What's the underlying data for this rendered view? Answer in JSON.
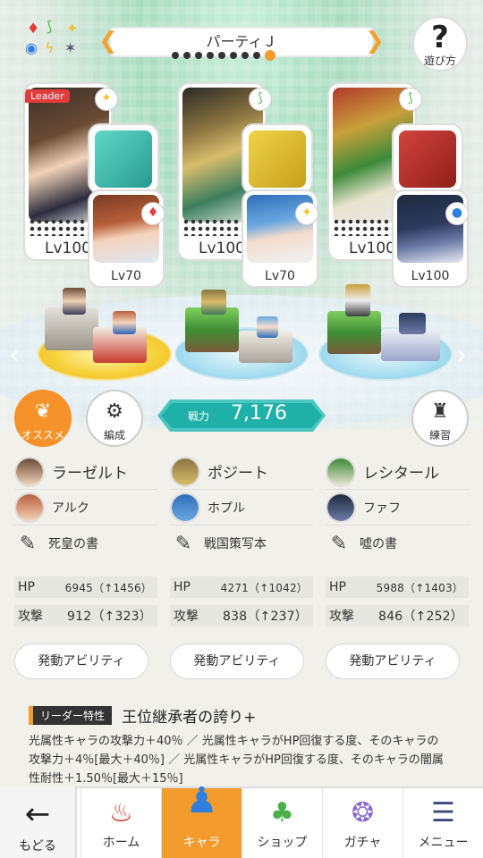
{
  "header": {
    "title": "パーティＪ",
    "page_count": 9,
    "active_page": 9,
    "help_label": "遊び方"
  },
  "colors": {
    "accent": "#f39b2c",
    "power_bg": "#1fb0a8",
    "leader_tag": "#e23b3b"
  },
  "party": [
    {
      "leader_tag": "Leader",
      "main_level": "Lv100",
      "main_element": "light",
      "main_badge": "✦",
      "sub_level": "Lv70",
      "sub_element": "fire",
      "sub_badge": "♦"
    },
    {
      "leader_tag": "",
      "main_level": "Lv100",
      "main_element": "wind",
      "main_badge": "⟆",
      "sub_level": "Lv70",
      "sub_element": "light",
      "sub_badge": "✦"
    },
    {
      "leader_tag": "",
      "main_level": "Lv100",
      "main_element": "wind",
      "main_badge": "⟆",
      "sub_level": "Lv100",
      "sub_element": "dark",
      "sub_badge": "●"
    }
  ],
  "buttons": {
    "recommend": "オススメ",
    "organize": "編成",
    "practice": "練習"
  },
  "power": {
    "label": "戦力",
    "value": "7,176"
  },
  "members": [
    {
      "main_name": "ラーゼルト",
      "sub_name": "アルク",
      "book": "死皇の書",
      "hp_label": "HP",
      "hp": "6945（↑1456）",
      "atk_label": "攻撃",
      "atk": "912（↑323）",
      "ability_label": "発動アビリティ"
    },
    {
      "main_name": "ポジート",
      "sub_name": "ホプル",
      "book": "戦国策写本",
      "hp_label": "HP",
      "hp": "4271（↑1042）",
      "atk_label": "攻撃",
      "atk": "838（↑237）",
      "ability_label": "発動アビリティ"
    },
    {
      "main_name": "レシタール",
      "sub_name": "ファフ",
      "book": "噓の書",
      "hp_label": "HP",
      "hp": "5988（↑1403）",
      "atk_label": "攻撃",
      "atk": "846（↑252）",
      "ability_label": "発動アビリティ"
    }
  ],
  "leader_skill": {
    "tag": "リーダー特性",
    "title": "王位継承者の誇り+",
    "description": "光属性キャラの攻撃力＋40％ ／ 光属性キャラがHP回復する度、そのキャラの攻撃力＋4％[最大＋40％] ／ 光属性キャラがHP回復する度、そのキャラの闇属性耐性＋1.50％[最大＋15％]"
  },
  "bottom_nav": {
    "back": "もどる",
    "tabs": [
      {
        "label": "ホーム",
        "icon": "home-icon"
      },
      {
        "label": "キャラ",
        "icon": "character-icon",
        "active": true
      },
      {
        "label": "ショップ",
        "icon": "shop-icon"
      },
      {
        "label": "ガチャ",
        "icon": "gacha-icon"
      },
      {
        "label": "メニュー",
        "icon": "menu-icon"
      }
    ]
  }
}
